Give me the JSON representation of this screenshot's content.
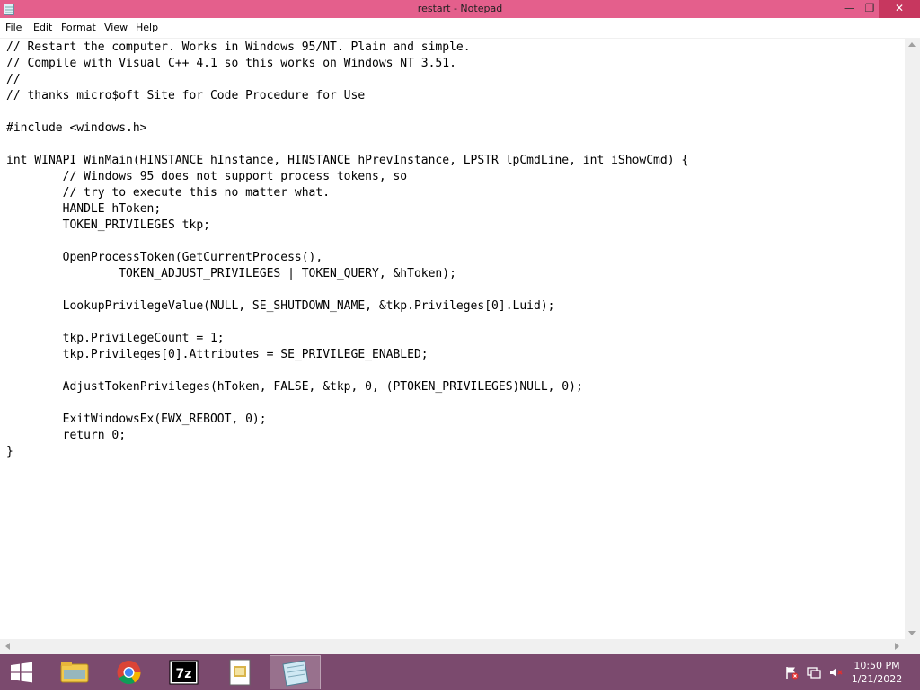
{
  "window": {
    "title": "restart - Notepad",
    "controls": {
      "minimize": "—",
      "maximize": "❐",
      "close": "✕"
    }
  },
  "menu": [
    {
      "label": "File"
    },
    {
      "label": "Edit"
    },
    {
      "label": "Format"
    },
    {
      "label": "View"
    },
    {
      "label": "Help"
    }
  ],
  "editor": {
    "lines": [
      "// Restart the computer. Works in Windows 95/NT. Plain and simple.",
      "// Compile with Visual C++ 4.1 so this works on Windows NT 3.51.",
      "//",
      "// thanks micro$oft Site for Code Procedure for Use",
      "",
      "#include <windows.h>",
      "",
      "int WINAPI WinMain(HINSTANCE hInstance, HINSTANCE hPrevInstance, LPSTR lpCmdLine, int iShowCmd) {",
      "        // Windows 95 does not support process tokens, so",
      "        // try to execute this no matter what.",
      "        HANDLE hToken;",
      "        TOKEN_PRIVILEGES tkp;",
      "",
      "        OpenProcessToken(GetCurrentProcess(),",
      "                TOKEN_ADJUST_PRIVILEGES | TOKEN_QUERY, &hToken);",
      "",
      "        LookupPrivilegeValue(NULL, SE_SHUTDOWN_NAME, &tkp.Privileges[0].Luid);",
      "",
      "        tkp.PrivilegeCount = 1;",
      "        tkp.Privileges[0].Attributes = SE_PRIVILEGE_ENABLED;",
      "",
      "        AdjustTokenPrivileges(hToken, FALSE, &tkp, 0, (PTOKEN_PRIVILEGES)NULL, 0);",
      "",
      "        ExitWindowsEx(EWX_REBOOT, 0);",
      "        return 0;",
      "}"
    ]
  },
  "taskbar": {
    "pinned": [
      {
        "icon": "file-explorer-icon"
      },
      {
        "icon": "chrome-icon"
      },
      {
        "icon": "7zip-icon",
        "text": "7z"
      },
      {
        "icon": "document-app-icon"
      },
      {
        "icon": "notepad-icon"
      }
    ],
    "tray_icons": [
      "action-center-flag-icon",
      "network-icon",
      "volume-muted-icon"
    ],
    "clock": {
      "time": "10:50 PM",
      "date": "1/21/2022"
    }
  },
  "colors": {
    "titlebar": "#e45f8c",
    "close_button": "#c7375f",
    "taskbar": "#7b4a6e",
    "editor_background": "#ffffff",
    "scrollbar": "#f0f0f0"
  }
}
